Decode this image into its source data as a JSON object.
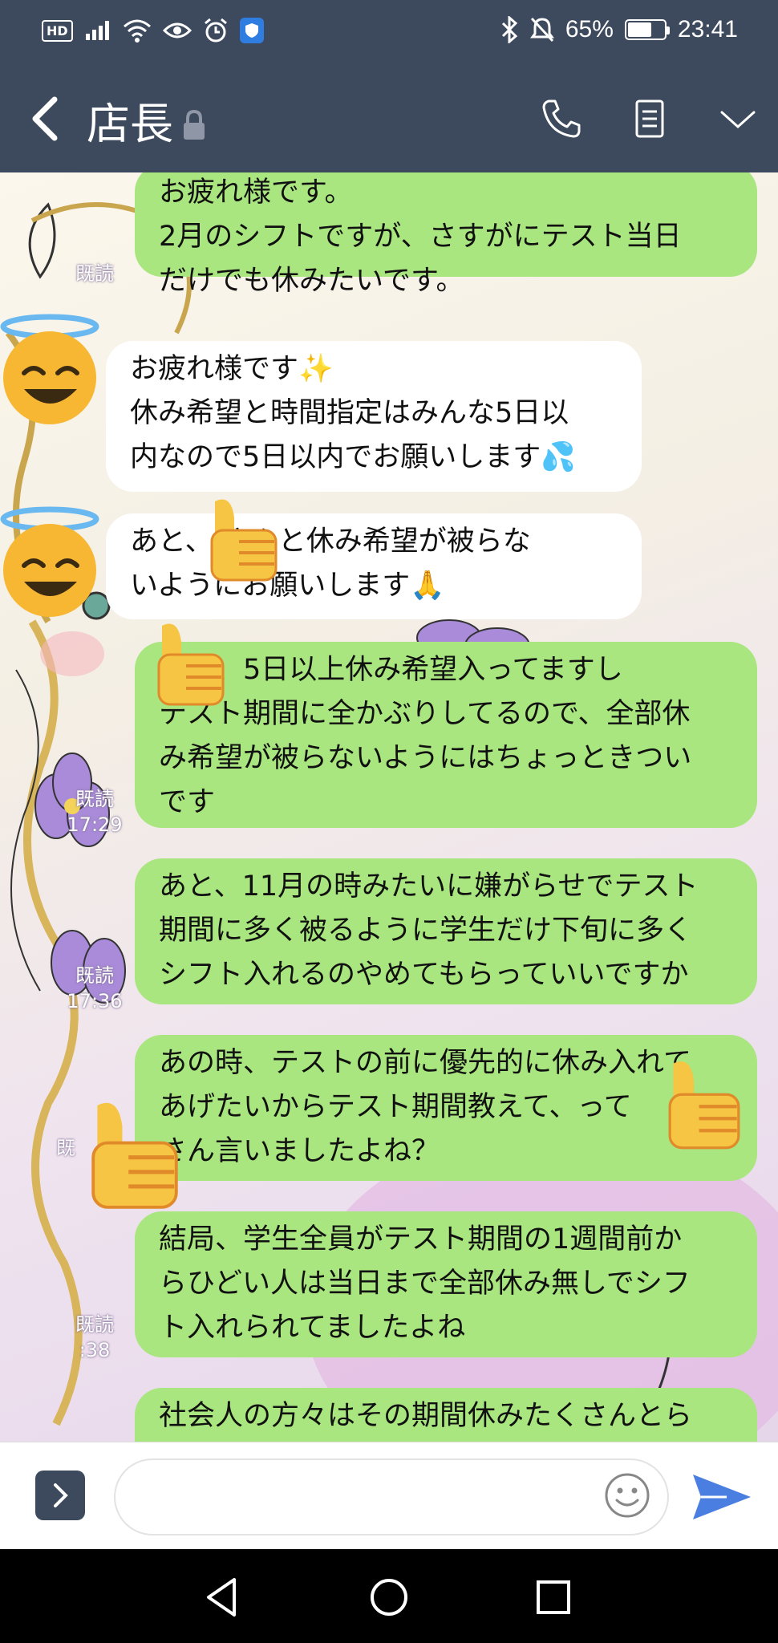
{
  "status_bar": {
    "hd": "HD",
    "battery_text": "65%",
    "battery_level": 0.65,
    "time": "23:41"
  },
  "header": {
    "title": "店長"
  },
  "messages": [
    {
      "dir": "out",
      "text": "お疲れ様です。\n2月のシフトですが、さすがにテスト当日\nだけでも休みたいです。"
    },
    {
      "dir": "in",
      "text": "お疲れ様です✨\n休み希望と時間指定はみんな5日以\n内なので5日以内でお願いします💦"
    },
    {
      "dir": "in",
      "text": "あと、      さんと休み希望が被らな\nいようにお願いします🙏"
    },
    {
      "dir": "out",
      "text": "      さん、5日以上休み希望入ってますし\nテスト期間に全かぶりしてるので、全部休\nみ希望が被らないようにはちょっときつい\nです"
    },
    {
      "dir": "out",
      "text": "あと、11月の時みたいに嫌がらせでテスト\n期間に多く被るように学生だけ下旬に多く\nシフト入れるのやめてもらっていいですか"
    },
    {
      "dir": "out",
      "text": "あの時、テストの前に優先的に休み入れて\nあげたいからテスト期間教えて、って\n      さん言いましたよね？"
    },
    {
      "dir": "out",
      "text": "結局、学生全員がテスト期間の1週間前か\nらひどい人は当日まで全部休み無しでシフ\nト入れられてましたよね"
    },
    {
      "dir": "out",
      "text": "社会人の方々はその期間休みたくさんとら"
    }
  ],
  "read_receipts": [
    {
      "label": "既読",
      "time": ""
    },
    {
      "label": "既読",
      "time": "17:29"
    },
    {
      "label": "既読",
      "time": "17:36"
    },
    {
      "label": "既",
      "time": ""
    },
    {
      "label": "既読",
      "time": ":38"
    }
  ],
  "icons": {
    "back": "chevron-left-icon",
    "lock": "lock-icon",
    "call": "phone-icon",
    "notes": "notes-icon",
    "menu": "chevron-down-icon",
    "avatar": "smiling-face-with-halo",
    "sticker": "thumbs-up",
    "send": "send-icon",
    "emoji": "smiley-icon"
  },
  "colors": {
    "header": "#3d4a5e",
    "outgoing_bubble": "#a9e67f",
    "incoming_bubble": "#ffffff",
    "send": "#4a7ee0"
  },
  "input": {
    "value": "",
    "placeholder": ""
  }
}
